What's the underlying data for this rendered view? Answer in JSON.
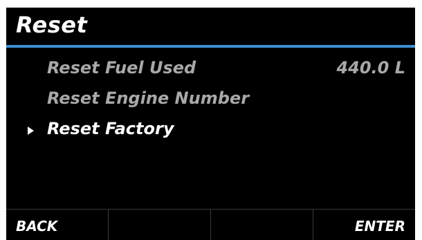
{
  "header": {
    "title": "Reset"
  },
  "menu": {
    "items": [
      {
        "label": "Reset Fuel Used",
        "value": "440.0 L",
        "selected": false
      },
      {
        "label": "Reset Engine Number",
        "value": "",
        "selected": false
      },
      {
        "label": "Reset Factory",
        "value": "",
        "selected": true
      }
    ],
    "cursor_icon": "triangle-right-icon"
  },
  "softkeys": {
    "key1": "BACK",
    "key2": "",
    "key3": "",
    "key4": "ENTER"
  },
  "colors": {
    "background": "#000000",
    "accent_rule": "#3f8fd2",
    "selected_text": "#ffffff",
    "unselected_text": "#a8a8a8",
    "divider": "#3a3a3a"
  }
}
